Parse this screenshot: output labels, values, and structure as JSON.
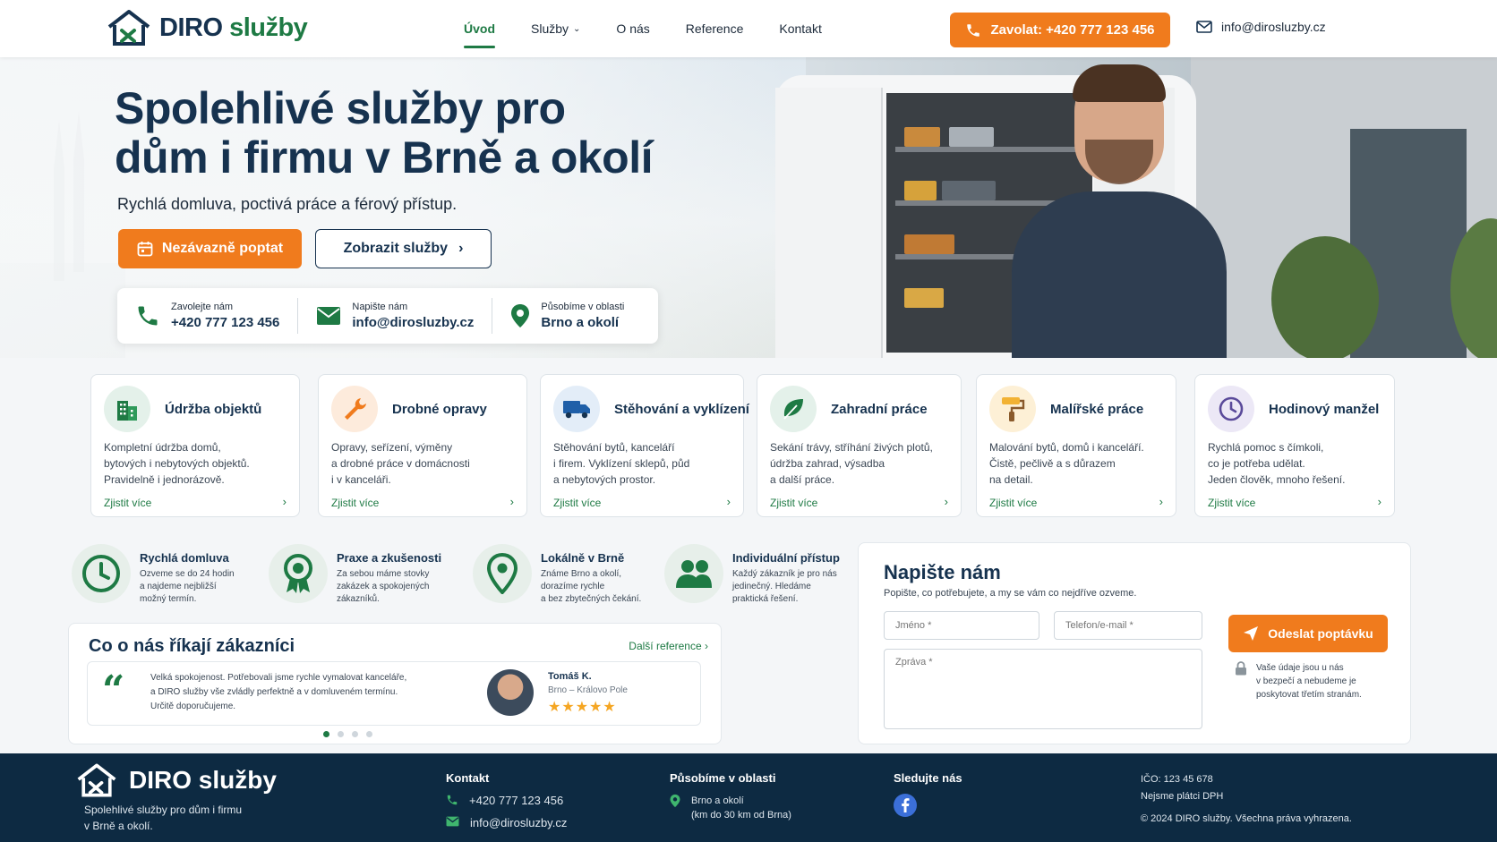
{
  "brand": {
    "name_main": "DIRO",
    "name_accent": "služby",
    "colors": {
      "primary": "#16324f",
      "green": "#1e7a44",
      "orange": "#f07b1d"
    }
  },
  "nav": {
    "items": [
      {
        "label": "Úvod",
        "active": true
      },
      {
        "label": "Služby",
        "active": false,
        "dropdown": true
      },
      {
        "label": "O nás",
        "active": false
      },
      {
        "label": "Reference",
        "active": false
      },
      {
        "label": "Kontakt",
        "active": false
      }
    ],
    "call_label": "Zavolat: +420 777 123 456",
    "email": "info@dirosluzby.cz"
  },
  "hero": {
    "title_line1": "Spolehlivé služby pro",
    "title_line2": "dům i firmu v Brně a okolí",
    "subtitle": "Rychlá domluva, poctivá práce a férový přístup.",
    "primary_button": "Nezávazně poptat",
    "secondary_button": "Zobrazit služby",
    "contacts": [
      {
        "label": "Zavolejte nám",
        "value": "+420 777 123 456",
        "icon": "phone-icon"
      },
      {
        "label": "Napište nám",
        "value": "info@dirosluzby.cz",
        "icon": "mail-icon"
      },
      {
        "label": "Působíme v oblasti",
        "value": "Brno a okolí",
        "icon": "location-pin-icon"
      }
    ]
  },
  "services": [
    {
      "title": "Údržba objektů",
      "desc": "Kompletní údržba domů,\nbytových i nebytových objektů.\nPravidelně i jednorázově.",
      "link": "Zjistit více",
      "icon": "building-icon",
      "icon_bg": "#e4f1ea"
    },
    {
      "title": "Drobné opravy",
      "desc": "Opravy, seřízení, výměny\na drobné práce v domácnosti\ni v kanceláři.",
      "link": "Zjistit více",
      "icon": "wrench-icon",
      "icon_bg": "#fdebdc"
    },
    {
      "title": "Stěhování a vyklízení",
      "desc": "Stěhování bytů, kanceláří\ni firem. Vyklízení sklepů, půd\na nebytových prostor.",
      "link": "Zjistit více",
      "icon": "truck-icon",
      "icon_bg": "#e3edf8"
    },
    {
      "title": "Zahradní práce",
      "desc": "Sekání trávy, stříhání živých plotů,\núdržba zahrad, výsadba\na další práce.",
      "link": "Zjistit více",
      "icon": "leaf-icon",
      "icon_bg": "#e4f1ea"
    },
    {
      "title": "Malířské práce",
      "desc": "Malování bytů, domů i kanceláří.\nČistě, pečlivě a s důrazem\nna detail.",
      "link": "Zjistit více",
      "icon": "paint-roller-icon",
      "icon_bg": "#fdf0d6"
    },
    {
      "title": "Hodinový manžel",
      "desc": "Rychlá pomoc s čímkoli,\nco je potřeba udělat.\nJeden člověk, mnoho řešení.",
      "link": "Zjistit více",
      "icon": "clock-icon",
      "icon_bg": "#ece8f6"
    }
  ],
  "features": [
    {
      "title": "Rychlá domluva",
      "desc": "Ozveme se do 24 hodin\na najdeme nejbližší\nmožný termín.",
      "icon": "clock-icon"
    },
    {
      "title": "Praxe a zkušenosti",
      "desc": "Za sebou máme stovky\nzakázek a spokojených\nzákazníků.",
      "icon": "award-icon"
    },
    {
      "title": "Lokálně v Brně",
      "desc": "Známe Brno a okolí,\ndorazíme rychle\na bez zbytečných čekání.",
      "icon": "location-pin-icon"
    },
    {
      "title": "Individuální přístup",
      "desc": "Každý zákazník je pro nás\njedinečný. Hledáme\npraktická řešení.",
      "icon": "people-icon"
    }
  ],
  "reviews": {
    "title": "Co o nás říkají zákazníci",
    "more_link": "Další reference",
    "text": "Velká spokojenost. Potřebovali jsme rychle vymalovat kanceláře,\na DIRO služby vše zvládly perfektně a v domluveném termínu.\nUrčitě doporučujeme.",
    "author": "Tomáš K.",
    "location": "Brno – Královo Pole",
    "rating": 5,
    "rating_stars": "★★★★★",
    "pages": 4,
    "current_page": 1
  },
  "form": {
    "title": "Napište nám",
    "subtitle": "Popište, co potřebujete, a my se vám co nejdříve ozveme.",
    "name_placeholder": "Jméno *",
    "contact_placeholder": "Telefon/e-mail *",
    "message_placeholder": "Zpráva *",
    "submit": "Odeslat poptávku",
    "privacy": "Vaše údaje jsou u nás\nv bezpečí a nebudeme je\nposkytovat třetím stranám."
  },
  "footer": {
    "tagline": "Spolehlivé služby pro dům i firmu\nv Brně a okolí.",
    "contact_heading": "Kontakt",
    "phone": "+420 777 123 456",
    "email": "info@dirosluzby.cz",
    "area_heading": "Působíme v oblasti",
    "area": "Brno a okolí\n(km do 30 km od Brna)",
    "social_heading": "Sledujte nás",
    "ico": "IČO: 123 45 678",
    "vat": "Nejsme plátci DPH",
    "copyright": "© 2024 DIRO služby. Všechna práva vyhrazena."
  }
}
